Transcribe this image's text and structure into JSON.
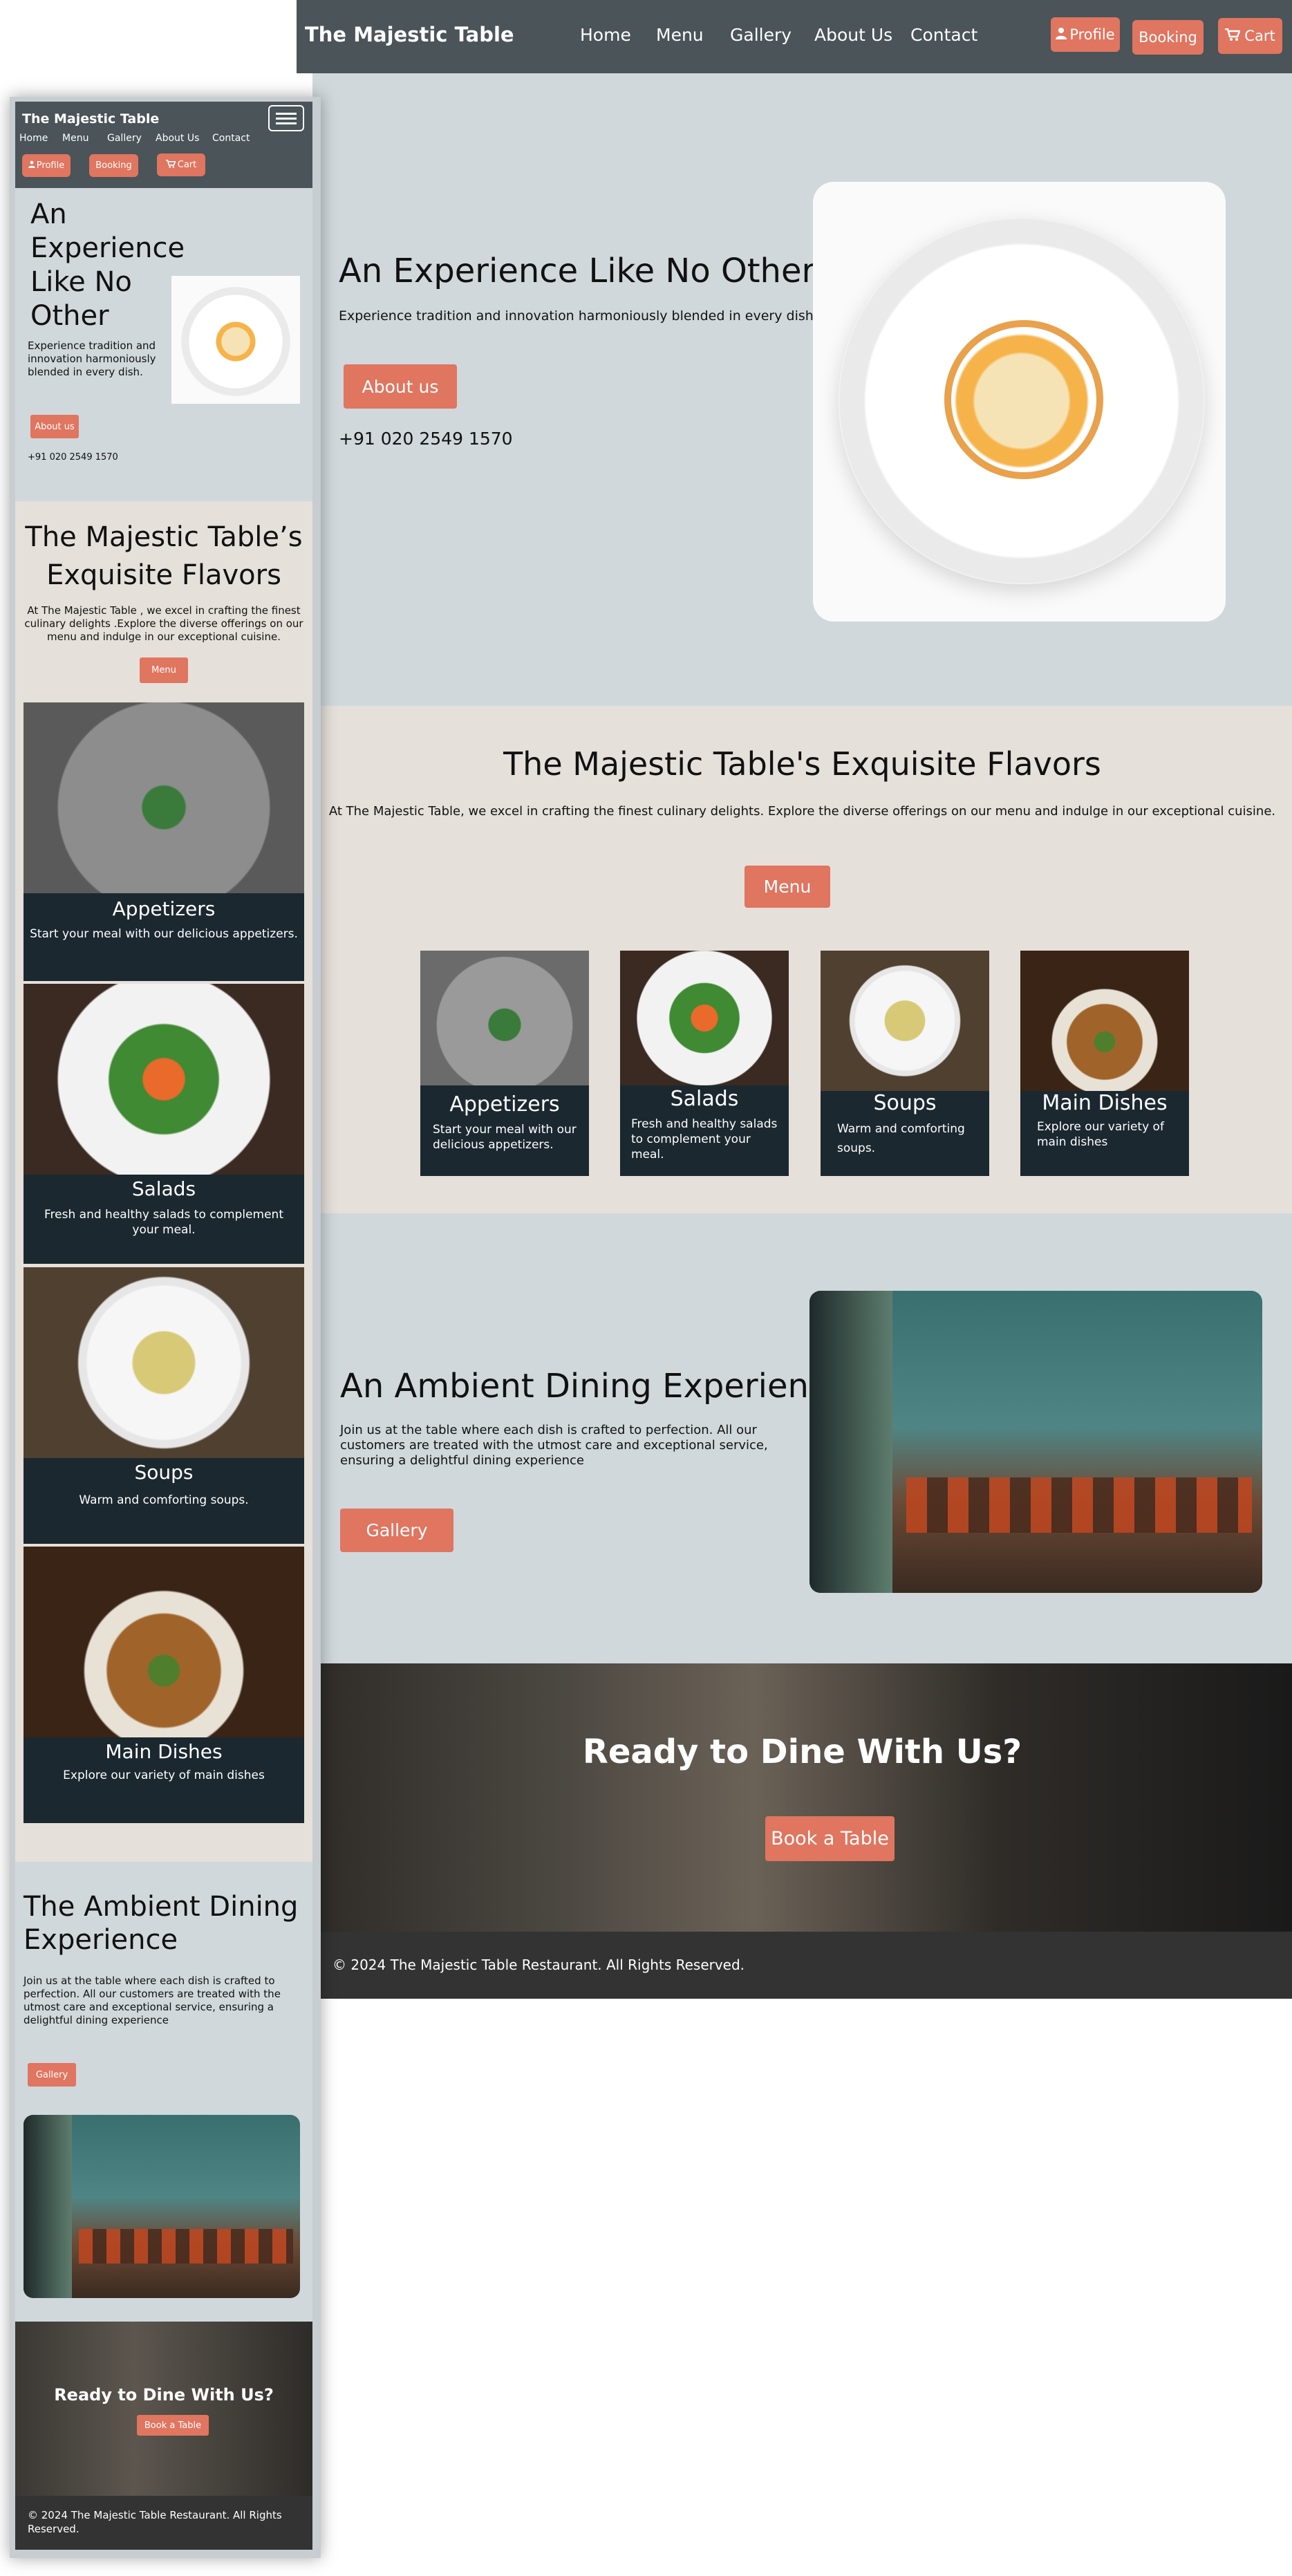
{
  "brand": "The Majestic Table",
  "nav": {
    "items": [
      "Home",
      "Menu",
      "Gallery",
      "About Us",
      "Contact"
    ],
    "profile": "Profile",
    "booking": "Booking",
    "cart": "Cart"
  },
  "hero": {
    "title": "An Experience Like No Other",
    "subtitle": "Experience tradition and innovation harmoniously blended in every dish.",
    "button": "About us",
    "phone": "+91 020 2549 1570"
  },
  "flavors": {
    "title_desktop": "The Majestic Table's Exquisite Flavors",
    "title_mobile": "The Majestic Table’s Exquisite Flavors",
    "desc_desktop": "At The Majestic Table, we excel in crafting the finest culinary delights. Explore the diverse offerings on our menu and indulge in our exceptional cuisine.",
    "desc_mobile": "At The Majestic Table , we excel in crafting the finest culinary delights .Explore the diverse offerings on our menu and indulge in our exceptional cuisine.",
    "button": "Menu",
    "cards": [
      {
        "title": "Appetizers",
        "text": "Start your meal with our delicious appetizers."
      },
      {
        "title": "Salads",
        "text": "Fresh and healthy salads to complement your meal."
      },
      {
        "title": "Soups",
        "text": "Warm and comforting soups."
      },
      {
        "title": "Main Dishes",
        "text": "Explore our variety of main dishes"
      }
    ]
  },
  "ambient": {
    "title_desktop": "An Ambient Dining Experience",
    "title_mobile": "The Ambient Dining Experience",
    "desc": "Join us at the table where each dish is crafted to perfection. All our customers are treated with the utmost care and exceptional service, ensuring a delightful dining experience",
    "button": "Gallery"
  },
  "ready": {
    "title": "Ready to Dine With Us?",
    "button": "Book a Table"
  },
  "footer": {
    "text": "© 2024 The Majestic Table Restaurant. All Rights Reserved."
  },
  "colors": {
    "nav_bg": "#4a5459",
    "accent": "#e07560",
    "section_gray": "#d0d8dc",
    "section_beige": "#e6e0da",
    "card_dark": "#1b2830",
    "footer_bg": "#333333"
  },
  "icons": [
    "user-icon",
    "cart-icon",
    "hamburger-icon"
  ]
}
